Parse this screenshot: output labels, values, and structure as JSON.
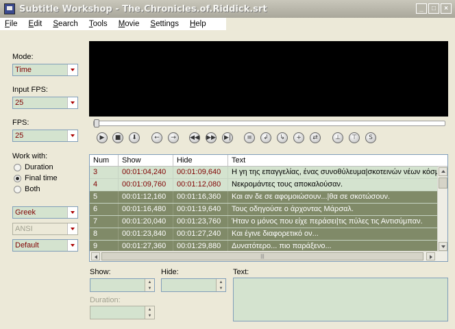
{
  "window": {
    "title": "Subtitle Workshop - The.Chronicles.of.Riddick.srt",
    "minimize": "_",
    "maximize": "□",
    "close": "×"
  },
  "menu": [
    {
      "label": "File",
      "mnemonic": "F",
      "rest": "ile"
    },
    {
      "label": "Edit",
      "mnemonic": "E",
      "rest": "dit"
    },
    {
      "label": "Search",
      "mnemonic": "S",
      "rest": "earch"
    },
    {
      "label": "Tools",
      "mnemonic": "T",
      "rest": "ools"
    },
    {
      "label": "Movie",
      "mnemonic": "M",
      "rest": "ovie"
    },
    {
      "label": "Settings",
      "mnemonic": "S",
      "rest": "ettings"
    },
    {
      "label": "Help",
      "mnemonic": "H",
      "rest": "elp"
    }
  ],
  "left": {
    "mode_label": "Mode:",
    "mode_value": "Time",
    "input_fps_label": "Input FPS:",
    "input_fps_value": "25",
    "fps_label": "FPS:",
    "fps_value": "25",
    "work_with_label": "Work with:",
    "work_options": [
      {
        "label": "Duration",
        "checked": false
      },
      {
        "label": "Final time",
        "checked": true
      },
      {
        "label": "Both",
        "checked": false
      }
    ],
    "charset_value": "Greek",
    "encoding_value": "ANSI",
    "style_value": "Default"
  },
  "toolbar": [
    {
      "icon": "play-icon",
      "glyph": "▶"
    },
    {
      "icon": "stop-icon",
      "glyph": "■"
    },
    {
      "icon": "download-icon",
      "glyph": "⬇"
    },
    {
      "icon": "back-icon",
      "glyph": "←"
    },
    {
      "icon": "forward-icon",
      "glyph": "→"
    },
    {
      "icon": "rewind-icon",
      "glyph": "◀◀"
    },
    {
      "icon": "fast-forward-icon",
      "glyph": "▶▶"
    },
    {
      "icon": "next-icon",
      "glyph": "▶|"
    },
    {
      "icon": "align-icon",
      "glyph": "≡"
    },
    {
      "icon": "set-start-icon",
      "glyph": "↲"
    },
    {
      "icon": "set-end-icon",
      "glyph": "↳"
    },
    {
      "icon": "add-icon",
      "glyph": "+"
    },
    {
      "icon": "adjust-icon",
      "glyph": "⇄"
    },
    {
      "icon": "mark-start-icon",
      "glyph": "⊥"
    },
    {
      "icon": "mark-end-icon",
      "glyph": "⊤"
    },
    {
      "icon": "s-icon",
      "glyph": "S"
    }
  ],
  "grid": {
    "columns": [
      "Num",
      "Show",
      "Hide",
      "Text"
    ],
    "rows": [
      {
        "num": "3",
        "show": "00:01:04,240",
        "hide": "00:01:09,640",
        "text": "Η γη της επαγγελίας, ένας συνοθύλευμα|σκοτεινών νέων κόσμων",
        "selected": false
      },
      {
        "num": "4",
        "show": "00:01:09,760",
        "hide": "00:01:12,080",
        "text": "Νεκρομάντες τους αποκαλούσαν.",
        "selected": false
      },
      {
        "num": "5",
        "show": "00:01:12,160",
        "hide": "00:01:16,360",
        "text": "Και αν δε σε αφομοιώσουν...|θα σε σκοτώσουν.",
        "selected": true
      },
      {
        "num": "6",
        "show": "00:01:16,480",
        "hide": "00:01:19,640",
        "text": "Τους οδηγούσε ο άρχοντας Μάρσαλ.",
        "selected": true
      },
      {
        "num": "7",
        "show": "00:01:20,040",
        "hide": "00:01:23,760",
        "text": "Ήταν ο μόνος που είχε περάσει|τις πύλες τις Αντισύμπαν.",
        "selected": true
      },
      {
        "num": "8",
        "show": "00:01:23,840",
        "hide": "00:01:27,240",
        "text": "Και έγινε διαφορετικό ον...",
        "selected": true
      },
      {
        "num": "9",
        "show": "00:01:27,360",
        "hide": "00:01:29,880",
        "text": "Δυνατότερο... πιο παράξενο...",
        "selected": true
      }
    ]
  },
  "editor": {
    "show_label": "Show:",
    "hide_label": "Hide:",
    "text_label": "Text:",
    "duration_label": "Duration:"
  }
}
